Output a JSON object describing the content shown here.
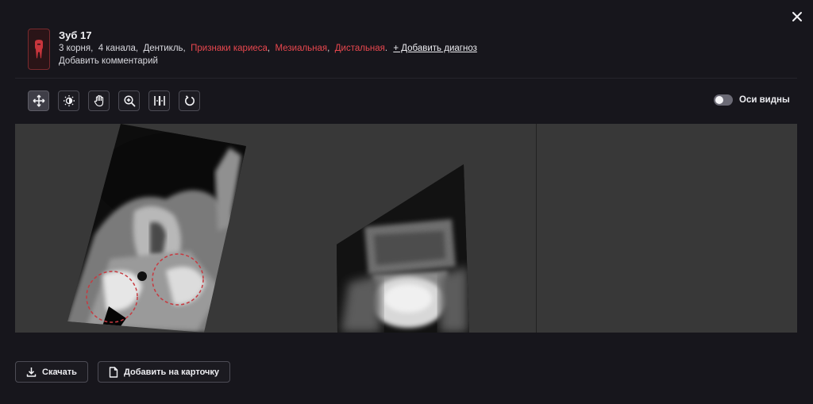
{
  "header": {
    "title": "Зуб 17",
    "details": {
      "roots": "3 корня,",
      "canals": "4 канала,",
      "dentin": "Дентикль,",
      "caries": "Признаки кариеса",
      "mesial": "Мезиальная",
      "distal": "Дистальная",
      "add_diagnosis": "+ Добавить диагноз"
    },
    "comment_label": "Добавить комментарий"
  },
  "toolbar": {
    "tools": [
      "move-icon",
      "brightness-icon",
      "pan-hand-icon",
      "zoom-icon",
      "measure-icon",
      "rotate-icon"
    ],
    "active_tool": "move-icon"
  },
  "axes_toggle": {
    "label": "Оси видны",
    "on": false
  },
  "footer": {
    "download_label": "Скачать",
    "add_to_card_label": "Добавить на карточку"
  },
  "colors": {
    "background": "#17161c",
    "accent_red": "#e8474e",
    "viewer_bg": "#383838"
  }
}
